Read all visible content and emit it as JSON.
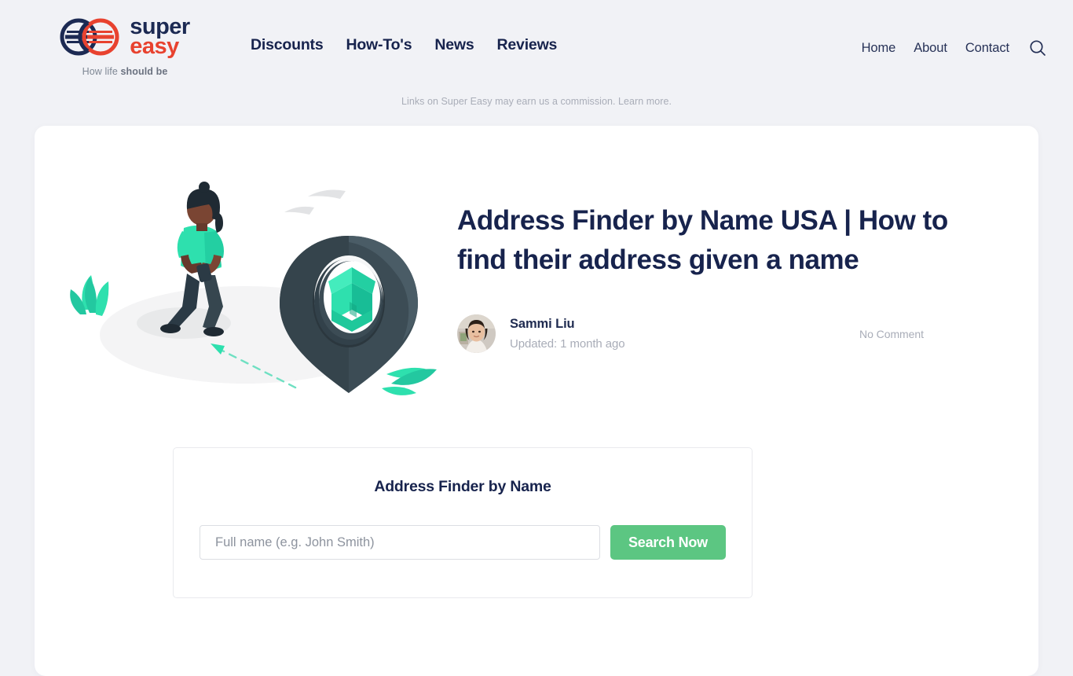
{
  "brand": {
    "name_line1": "super",
    "name_line2": "easy",
    "tagline_prefix": "How life ",
    "tagline_strong": "should be",
    "logo_icon": "interlocking-rings-logo",
    "color_navy": "#1c2a53",
    "color_red": "#e8422f"
  },
  "nav": {
    "primary": [
      {
        "label": "Discounts"
      },
      {
        "label": "How-To's"
      },
      {
        "label": "News"
      },
      {
        "label": "Reviews"
      }
    ],
    "secondary": [
      {
        "label": "Home"
      },
      {
        "label": "About"
      },
      {
        "label": "Contact"
      }
    ],
    "search_icon": "search-icon"
  },
  "disclosure": {
    "text": "Links on Super Easy may earn us a commission.",
    "link_label": "Learn more."
  },
  "article": {
    "title": "Address Finder by Name USA | How to find their address given a name",
    "author": "Sammi Liu",
    "updated": "Updated: 1 month ago",
    "comments": "No Comment",
    "illustration": "person-walking-with-phone-toward-map-pin-with-house"
  },
  "widget": {
    "title": "Address Finder by Name",
    "input_placeholder": "Full name (e.g. John Smith)",
    "input_value": "",
    "button_label": "Search Now",
    "button_color": "#5cc682"
  },
  "theme": {
    "page_background": "#f1f2f6",
    "card_background": "#ffffff",
    "heading_color": "#17234d",
    "muted_text": "#a9adb8",
    "accent_teal": "#2ee0ae",
    "pin_dark": "#3c4c55"
  }
}
